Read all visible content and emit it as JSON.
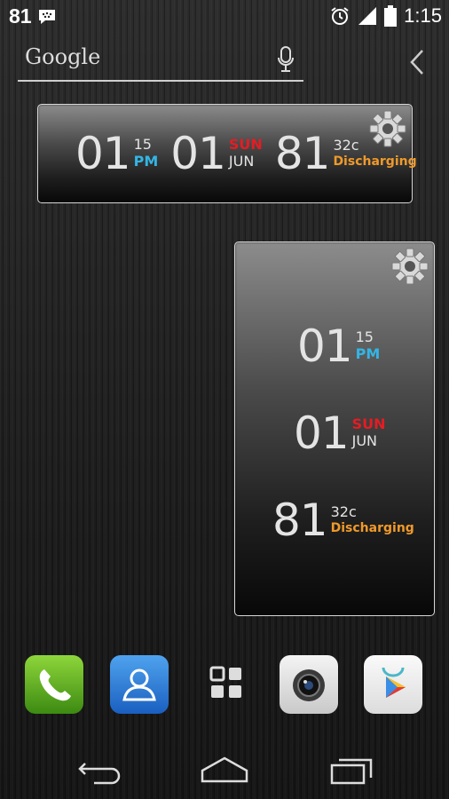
{
  "status_bar": {
    "notification_count": "81",
    "time": "1:15"
  },
  "search": {
    "logo_text": "Google"
  },
  "widget_horizontal": {
    "hour": "01",
    "minute": "15",
    "ampm": "PM",
    "day": "01",
    "weekday": "SUN",
    "month": "JUN",
    "battery": "81",
    "temperature": "32c",
    "battery_status": "Discharging"
  },
  "widget_vertical": {
    "hour": "01",
    "minute": "15",
    "ampm": "PM",
    "day": "01",
    "weekday": "SUN",
    "month": "JUN",
    "battery": "81",
    "temperature": "32c",
    "battery_status": "Discharging"
  },
  "dock": [
    "phone-icon",
    "contacts-icon",
    "app-drawer-icon",
    "camera-icon",
    "play-store-icon"
  ],
  "nav": [
    "back-icon",
    "home-icon",
    "recents-icon"
  ],
  "colors": {
    "accent_blue": "#33b5e5",
    "red": "#e51c23",
    "orange": "#ef9a2a"
  }
}
